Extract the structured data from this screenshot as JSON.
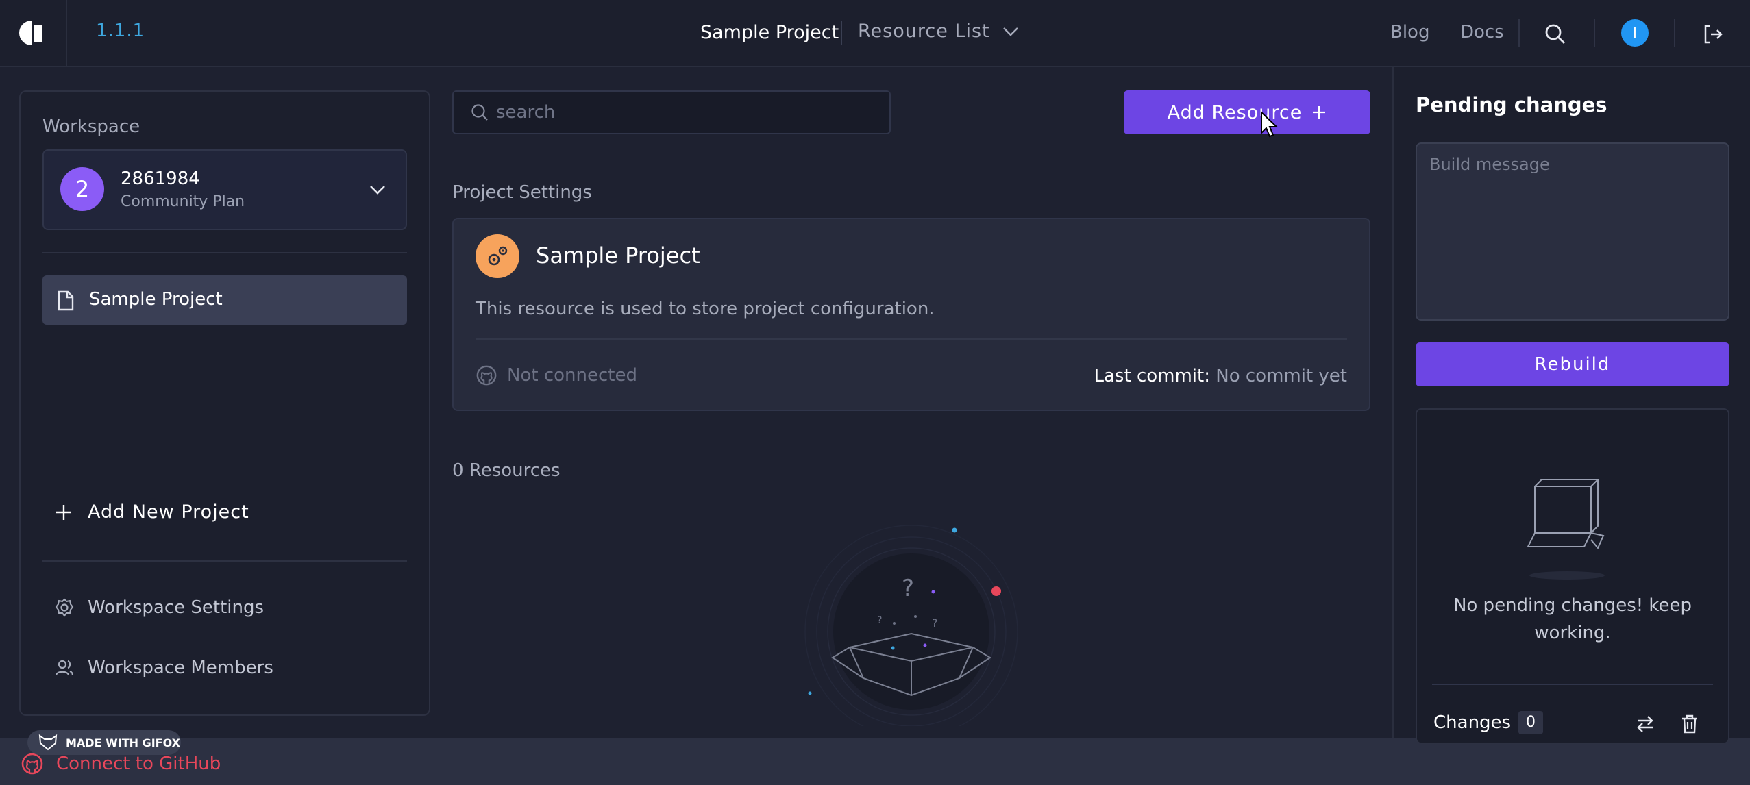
{
  "header": {
    "version": "1.1.1",
    "project_title": "Sample Project",
    "resource_list": "Resource List",
    "blog": "Blog",
    "docs": "Docs",
    "user_initial": "I"
  },
  "sidebar": {
    "workspace_label": "Workspace",
    "workspace": {
      "initial": "2",
      "name": "2861984",
      "plan": "Community Plan"
    },
    "projects": [
      {
        "label": "Sample Project"
      }
    ],
    "add_project": "Add New Project",
    "workspace_settings": "Workspace Settings",
    "workspace_members": "Workspace Members"
  },
  "bottom": {
    "gifox_badge": "MADE WITH GIFOX",
    "connect_github": "Connect to GitHub"
  },
  "main": {
    "search_placeholder": "search",
    "add_resource": "Add Resource",
    "project_settings_label": "Project Settings",
    "project_card": {
      "title": "Sample Project",
      "description": "This resource is used to store project configuration.",
      "github_status": "Not connected",
      "last_commit_label": "Last commit:",
      "last_commit_value": "No commit yet"
    },
    "resource_count": "0 Resources"
  },
  "pending": {
    "title": "Pending changes",
    "build_placeholder": "Build message",
    "rebuild": "Rebuild",
    "empty_message": "No pending changes! keep working.",
    "changes_label": "Changes",
    "changes_count": "0"
  },
  "colors": {
    "accent": "#6d45e4",
    "background": "#1e2130",
    "panel": "#1c1f2d",
    "link_red": "#e8475b",
    "version_blue": "#3ea8e0"
  }
}
